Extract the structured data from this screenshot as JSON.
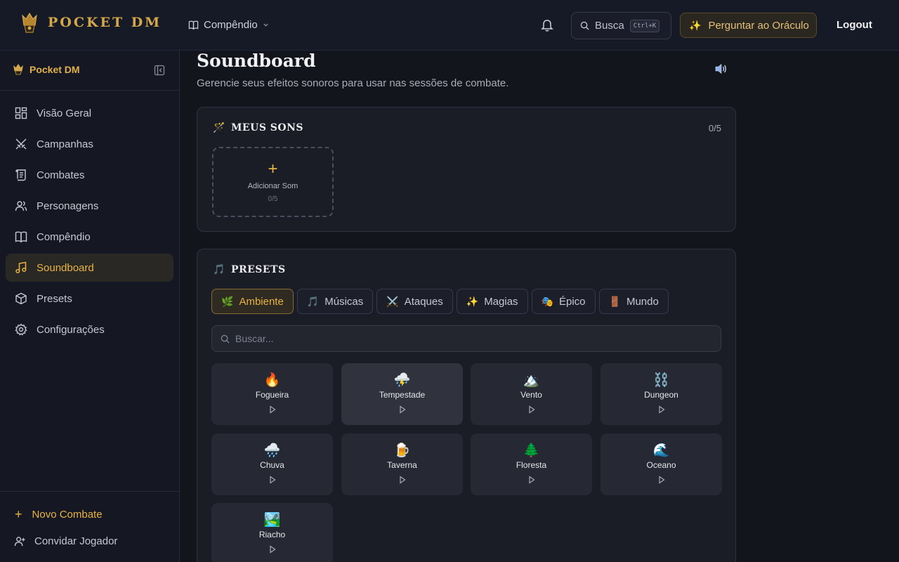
{
  "brand": {
    "name": "POCKET DM"
  },
  "topbar": {
    "compendium_label": "Compêndio",
    "search_label": "Busca",
    "search_shortcut": "Ctrl+K",
    "oracle_label": "Perguntar ao Oráculo",
    "logout_label": "Logout"
  },
  "sidebar": {
    "title": "Pocket DM",
    "items": [
      {
        "label": "Visão Geral",
        "icon": "grid-icon"
      },
      {
        "label": "Campanhas",
        "icon": "swords-icon"
      },
      {
        "label": "Combates",
        "icon": "scroll-icon"
      },
      {
        "label": "Personagens",
        "icon": "users-icon"
      },
      {
        "label": "Compêndio",
        "icon": "book-icon"
      },
      {
        "label": "Soundboard",
        "icon": "music-icon",
        "active": true
      },
      {
        "label": "Presets",
        "icon": "box-icon"
      },
      {
        "label": "Configurações",
        "icon": "gear-icon"
      }
    ],
    "new_combat_label": "Novo Combate",
    "invite_label": "Convidar Jogador"
  },
  "page": {
    "title": "Soundboard",
    "subtitle": "Gerencie seus efeitos sonoros para usar nas sessões de combate."
  },
  "my_sounds": {
    "title": "MEUS SONS",
    "count": "0/5",
    "add_label": "Adicionar Som",
    "add_count": "0/5"
  },
  "presets": {
    "title": "PRESETS",
    "search_placeholder": "Buscar...",
    "tabs": [
      {
        "label": "Ambiente",
        "icon": "🌿",
        "active": true
      },
      {
        "label": "Músicas",
        "icon": "🎵"
      },
      {
        "label": "Ataques",
        "icon": "⚔️"
      },
      {
        "label": "Magias",
        "icon": "✨"
      },
      {
        "label": "Épico",
        "icon": "🎭"
      },
      {
        "label": "Mundo",
        "icon": "🚪"
      }
    ],
    "sounds": [
      {
        "name": "Fogueira",
        "emoji": "🔥"
      },
      {
        "name": "Tempestade",
        "emoji": "⛈️"
      },
      {
        "name": "Vento",
        "emoji": "🏔️"
      },
      {
        "name": "Dungeon",
        "emoji": "⛓️"
      },
      {
        "name": "Chuva",
        "emoji": "🌧️"
      },
      {
        "name": "Taverna",
        "emoji": "🍺"
      },
      {
        "name": "Floresta",
        "emoji": "🌲"
      },
      {
        "name": "Oceano",
        "emoji": "🌊"
      },
      {
        "name": "Riacho",
        "emoji": "🏞️"
      }
    ]
  },
  "colors": {
    "accent": "#e8b343",
    "background": "#13151c",
    "card": "#1a1c26"
  }
}
